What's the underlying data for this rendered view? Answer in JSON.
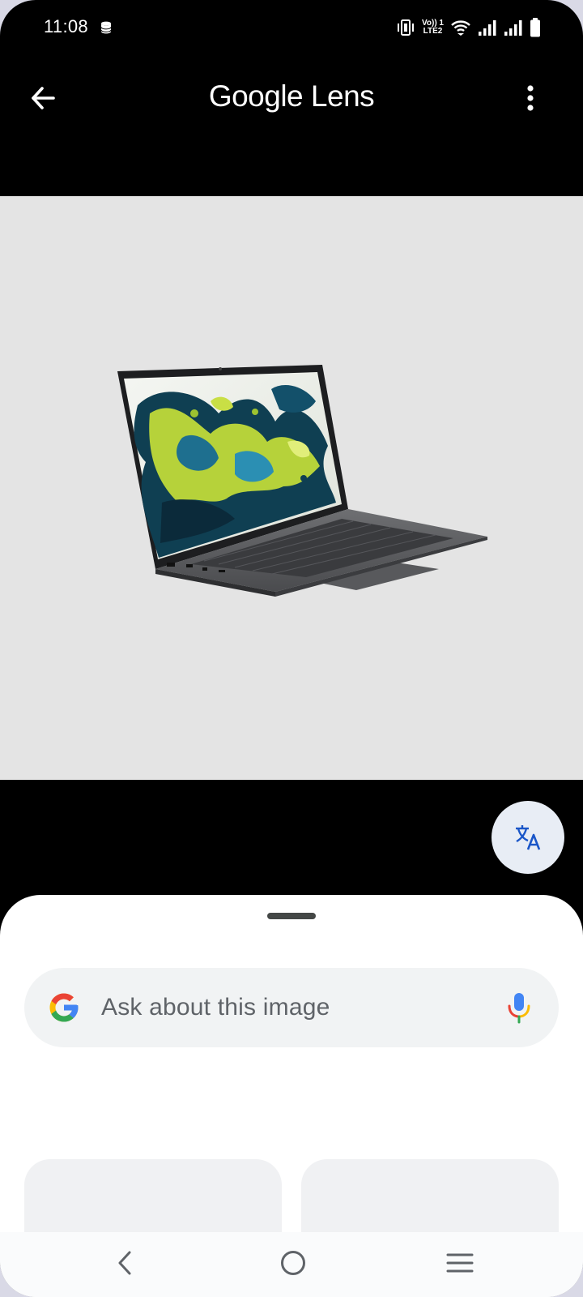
{
  "status_bar": {
    "time": "11:08",
    "icons": [
      "database-icon",
      "vibrate-icon",
      "volte-icon",
      "wifi-icon",
      "signal-icon",
      "signal-icon-2",
      "battery-icon"
    ],
    "volte_line1": "Vo)) 1",
    "volte_line2": "LTE2"
  },
  "app_bar": {
    "title": "Google Lens",
    "back_icon": "arrow-back-icon",
    "more_icon": "more-vert-icon"
  },
  "image": {
    "subject": "laptop",
    "background_color": "#e4e4e4"
  },
  "translate_button": {
    "icon": "translate-icon",
    "color": "#1a56c8"
  },
  "search": {
    "placeholder": "Ask about this image",
    "google_icon": "google-g-icon",
    "mic_icon": "mic-icon"
  },
  "nav_bar": {
    "icons": [
      "nav-back-icon",
      "home-icon",
      "recents-icon"
    ]
  },
  "colors": {
    "accent_blue": "#4285F4",
    "accent_red": "#EA4335",
    "accent_yellow": "#FBBC05",
    "accent_green": "#34A853"
  }
}
